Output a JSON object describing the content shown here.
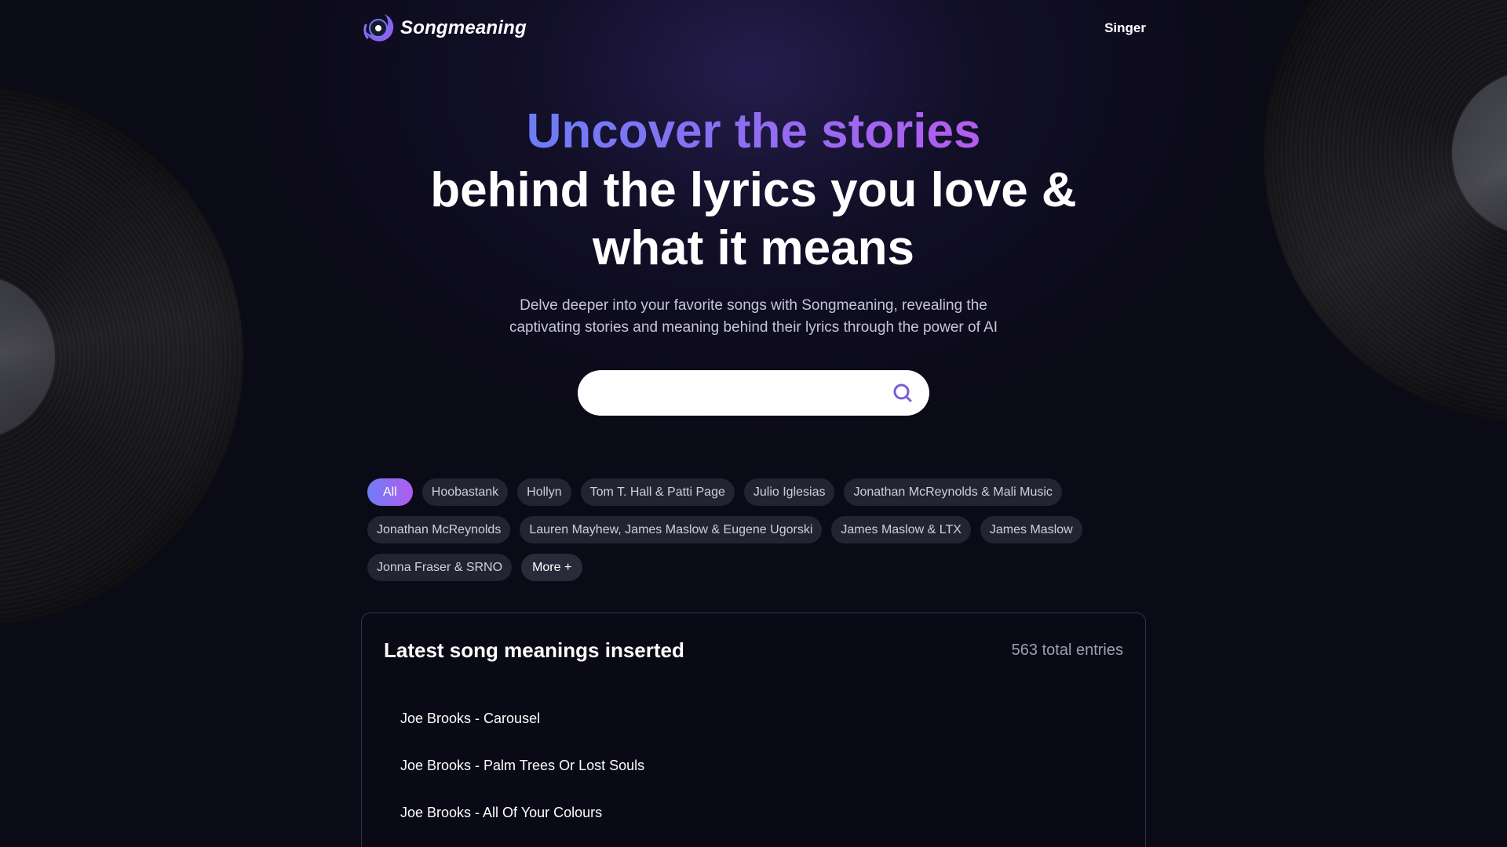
{
  "header": {
    "brand_name": "Songmeaning",
    "nav_singer": "Singer"
  },
  "hero": {
    "title_accent": "Uncover the stories",
    "title_line2": "behind the lyrics you love &",
    "title_line3": "what it means",
    "subtitle_line1": "Delve deeper into your favorite songs with Songmeaning, revealing the",
    "subtitle_line2": "captivating stories and meaning behind their lyrics through the power of AI"
  },
  "search": {
    "placeholder": "",
    "value": "",
    "icon": "search-icon"
  },
  "filters": {
    "chips": [
      "All",
      "Hoobastank",
      "Hollyn",
      "Tom T. Hall & Patti Page",
      "Julio Iglesias",
      "Jonathan McReynolds & Mali Music",
      "Jonathan McReynolds",
      "Lauren Mayhew, James Maslow & Eugene Ugorski",
      "James Maslow & LTX",
      "James Maslow",
      "Jonna Fraser & SRNO"
    ],
    "active": "All",
    "more_label": "More +"
  },
  "latest": {
    "title": "Latest song meanings inserted",
    "total": "563 total entries",
    "items": [
      "Joe Brooks - Carousel",
      "Joe Brooks - Palm Trees Or Lost Souls",
      "Joe Brooks - All Of Your Colours"
    ]
  },
  "colors": {
    "background": "#0b0a17",
    "accent_start": "#6d7cf6",
    "accent_end": "#b45cf0",
    "chip_bg": "#232333",
    "search_icon": "#7b5cd6"
  }
}
